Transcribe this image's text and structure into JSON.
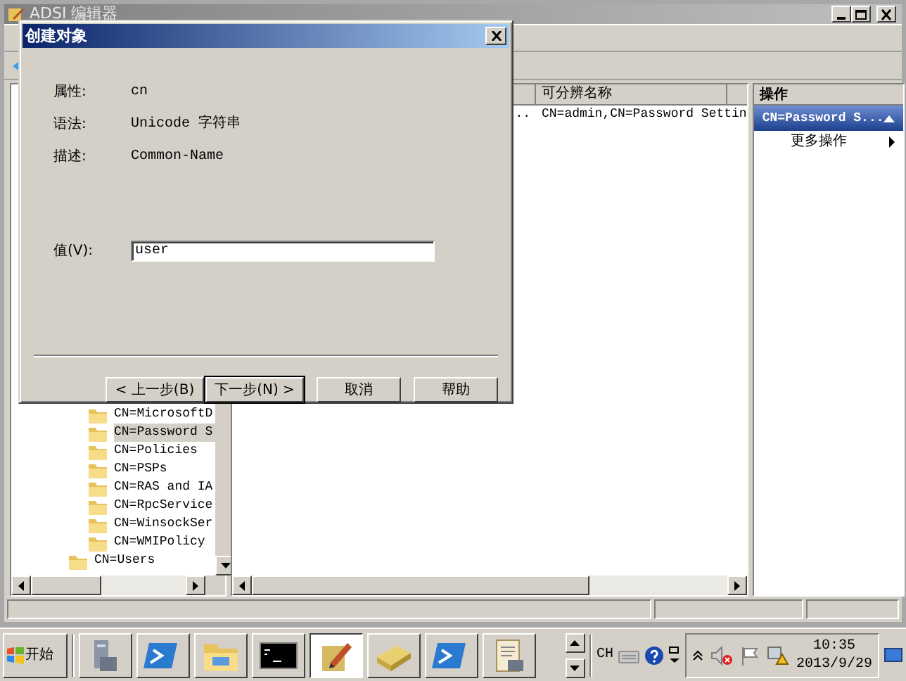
{
  "window": {
    "title": "ADSI 编辑器"
  },
  "tree": [
    {
      "children": [
        {
          "label": "CN=MicrosoftD",
          "selected": false
        },
        {
          "label": "CN=Password S",
          "selected": true
        },
        {
          "label": "CN=Policies",
          "selected": false
        },
        {
          "label": "CN=PSPs",
          "selected": false
        },
        {
          "label": "CN=RAS and IA",
          "selected": false
        },
        {
          "label": "CN=RpcService",
          "selected": false
        },
        {
          "label": "CN=WinsockSer",
          "selected": false
        },
        {
          "label": "CN=WMIPolicy",
          "selected": false
        }
      ]
    },
    {
      "label": "CN=Users",
      "selected": false
    }
  ],
  "list": {
    "columns": [
      "可分辨名称"
    ],
    "rows": [
      {
        "column_1": "..",
        "distinguished_name": "CN=admin,CN=Password Settin"
      }
    ]
  },
  "actions": {
    "title": "操作",
    "sections": [
      {
        "label": "CN=Password S...",
        "expanded": true,
        "items": [
          "更多操作"
        ]
      }
    ]
  },
  "dialog": {
    "title": "创建对象",
    "fields": [
      {
        "label": "属性:",
        "value": "cn"
      },
      {
        "label": "语法:",
        "value": "Unicode 字符串"
      },
      {
        "label": "描述:",
        "value": "Common-Name"
      }
    ],
    "input": {
      "label": "值(V):",
      "value": "user"
    },
    "buttons": [
      {
        "label": "< 上一步(B)",
        "default": false
      },
      {
        "label": "下一步(N) >",
        "default": true
      },
      {
        "label": "取消",
        "default": false
      },
      {
        "label": "帮助",
        "default": false
      }
    ]
  },
  "taskbar": {
    "start": "开始",
    "apps": [
      {
        "kind": "server",
        "selected": false
      },
      {
        "kind": "shell",
        "selected": false
      },
      {
        "kind": "folder",
        "selected": false
      },
      {
        "kind": "console",
        "selected": false
      },
      {
        "kind": "editor",
        "selected": true
      },
      {
        "kind": "book",
        "selected": false
      },
      {
        "kind": "shell",
        "selected": false
      },
      {
        "kind": "scroll",
        "selected": false
      }
    ],
    "language": "CH",
    "time": "10:35",
    "date": "2013/9/29"
  }
}
